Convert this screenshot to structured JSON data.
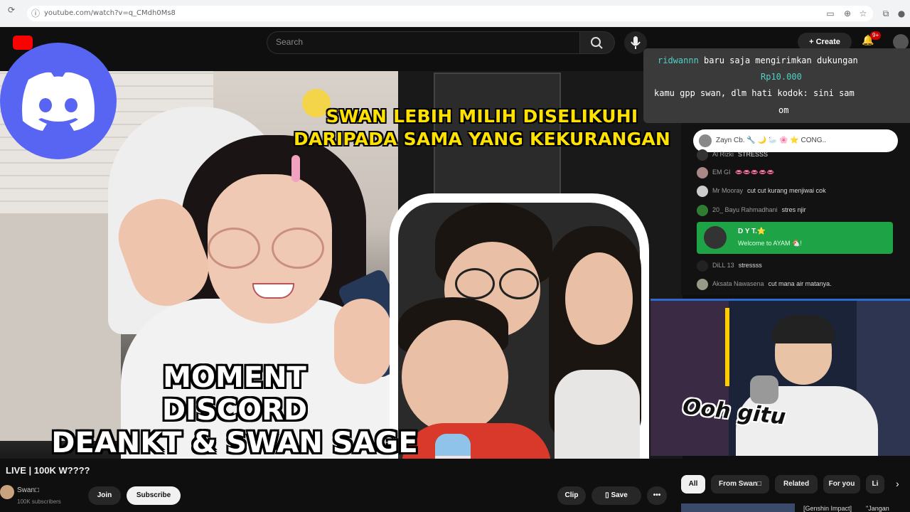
{
  "browser": {
    "url": "youtube.com/watch?v=q_CMdh0Ms8"
  },
  "header": {
    "search_placeholder": "Search",
    "create_label": "Create",
    "notif_count": "9+"
  },
  "captions": {
    "top_line1": "SWAN LEBIH MILIH DISELIKUHI",
    "top_line2": "DARIPADA SAMA YANG KEKURANGAN",
    "moment_line1": "MOMENT",
    "moment_line2": "DISCORD",
    "moment_line3": "DEANKT & SWAN SAGE",
    "ooh": "Ooh gitu"
  },
  "donation": {
    "line1": "ridwannn baru saja mengirimkan dukungan",
    "amount": "Rp10.000",
    "line2": "kamu gpp swan, dlm hati kodok: sini sam",
    "line3": "om"
  },
  "chat": {
    "bar_text": "Zayn Cb. 🔧 🌙  🦢  🌸  ⭐ CONG..",
    "messages": [
      {
        "name": "Al Rizki",
        "text": "STRESSS"
      },
      {
        "name": "EM GI",
        "text": "👄👄👄👄👄"
      },
      {
        "name": "Mr Mooray",
        "text": "cut cut kurang menjiwai cok"
      },
      {
        "name": "20_ Bayu Rahmadhani",
        "text": "stres njir"
      },
      {
        "name": "DiLL 13",
        "text": "stressss"
      },
      {
        "name": "Aksata Nawasena",
        "text": "cut mana air matanya."
      }
    ],
    "green_name": "D Y T.⭐",
    "green_text": "Welcome to AYAM 🐔!"
  },
  "video_info": {
    "title": "LIVE | 100K W????",
    "channel": "Swan□",
    "subscribers": "100K subscribers",
    "join": "Join",
    "subscribe": "Subscribe",
    "clip": "Clip",
    "save": "Save",
    "more": "•••"
  },
  "chips": [
    "All",
    "From Swan□",
    "Related",
    "For you",
    "Li"
  ],
  "up_next": {
    "title": "[Genshin Impact]",
    "title2": "\"Jangan"
  }
}
